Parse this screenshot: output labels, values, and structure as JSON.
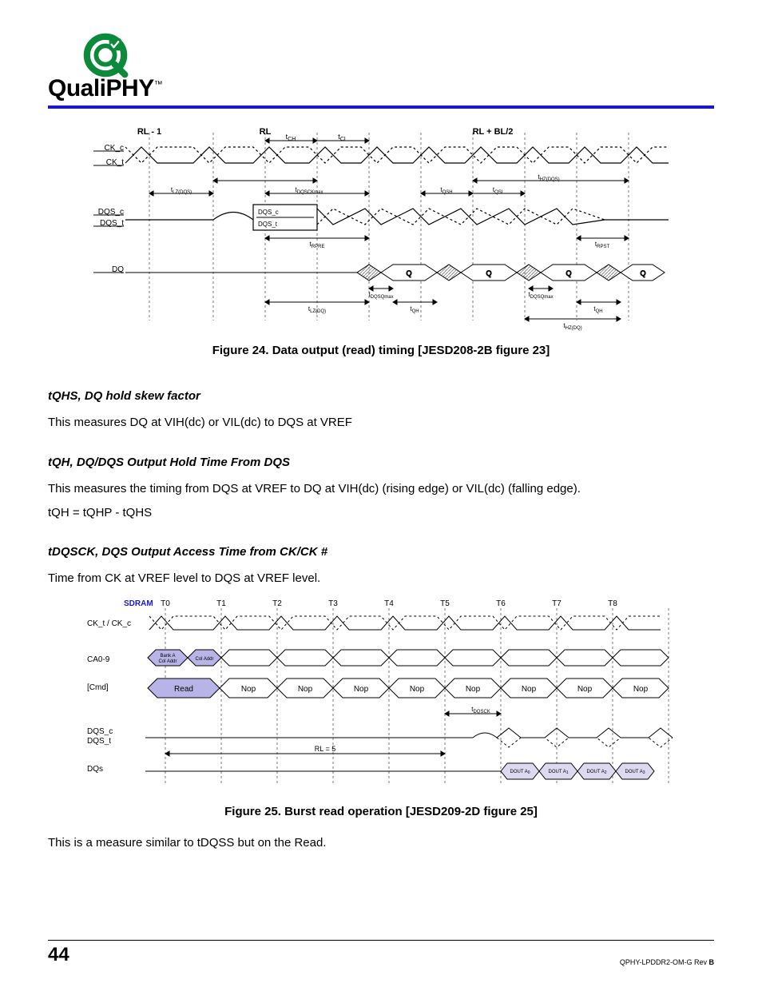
{
  "brand": {
    "name_a": "Quali",
    "name_b": "PHY",
    "tm": "™"
  },
  "fig24": {
    "caption": "Figure 24. Data output (read) timing [JESD208-2B figure 23]",
    "labels": {
      "rl_m1": "RL - 1",
      "rl": "RL",
      "rl_bl2": "RL + BL/2",
      "ck_c": "CK_c",
      "ck_t": "CK_t",
      "dqs_c": "DQS_c",
      "dqs_t": "DQS_t",
      "dq": "DQ",
      "tch": "t",
      "tch_sub": "CH",
      "tcl": "t",
      "tcl_sub": "CL",
      "tlzdqs": "t",
      "tlzdqs_sub": "LZ(DQS)",
      "tdqsckmax": "t",
      "tdqsckmax_sub": "DQSCKmax",
      "inner_dqs_c": "DQS_c",
      "inner_dqs_t": "DQS_t",
      "tqsh": "t",
      "tqsh_sub": "QSH",
      "tqsl": "t",
      "tqsl_sub": "QSL",
      "thzdqs": "t",
      "thzdqs_sub": "HZ(DQS)",
      "trpre": "t",
      "trpre_sub": "RPRE",
      "trpst": "t",
      "trpst_sub": "RPST",
      "q": "Q",
      "tdqsqmax": "t",
      "tdqsqmax_sub": "DQSQmax",
      "tlzdq": "t",
      "tlzdq_sub": "LZ(DQ)",
      "tqh": "t",
      "tqh_sub": "QH",
      "thzdq": "t",
      "thzdq_sub": "HZ(DQ)"
    }
  },
  "sec1": {
    "heading": "tQHS, DQ hold skew factor",
    "body": "This measures DQ at VIH(dc) or VIL(dc) to DQS at VREF"
  },
  "sec2": {
    "heading": "tQH, DQ/DQS Output Hold Time From DQS",
    "body1": "This measures the timing from DQS at VREF to DQ at VIH(dc) (rising edge) or VIL(dc) (falling edge).",
    "body2": "tQH = tQHP - tQHS"
  },
  "sec3": {
    "heading": "tDQSCK, DQS Output Access Time from CK/CK #",
    "body": "Time from CK at VREF level to DQS at VREF level."
  },
  "fig25": {
    "caption": "Figure 25. Burst read operation [JESD209-2D figure 25]",
    "labels": {
      "sdram": "SDRAM",
      "ckpair": "CK_t / CK_c",
      "ca": "CA0-9",
      "cmd": "[Cmd]",
      "dqs_c": "DQS_c",
      "dqs_t": "DQS_t",
      "dqs": "DQs",
      "t": [
        "T0",
        "T1",
        "T2",
        "T3",
        "T4",
        "T5",
        "T6",
        "T7",
        "T8"
      ],
      "bank": "Bank A\nCol Addr",
      "coladdr": "Col Addr",
      "read": "Read",
      "nop": "Nop",
      "rl": "RL = 5",
      "tdqsck": "t",
      "tdqsck_sub": "DQSCK",
      "dout": "DOUT A"
    }
  },
  "tail": "This is a measure similar to tDQSS but on the Read.",
  "footer": {
    "page": "44",
    "doc": "QPHY-LPDDR2-OM-G Rev ",
    "rev": "B"
  }
}
